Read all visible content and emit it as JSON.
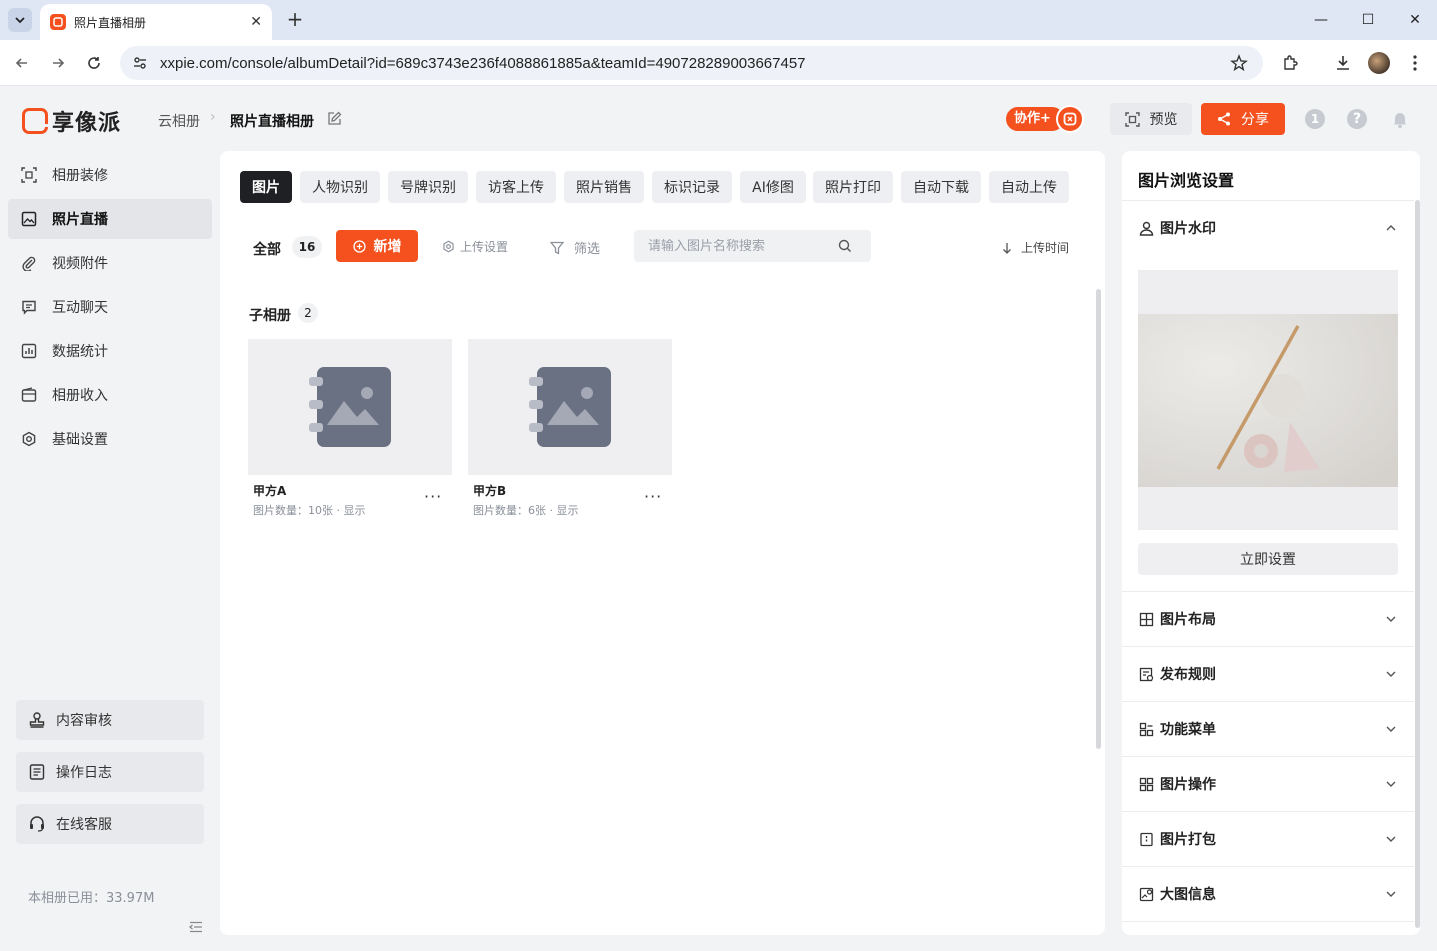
{
  "browser": {
    "tab_title": "照片直播相册",
    "url": "xxpie.com/console/albumDetail?id=689c3743e236f4088861885a&teamId=490728289003667457"
  },
  "header": {
    "logo_text": "享像派",
    "breadcrumb_parent": "云相册",
    "breadcrumb_current": "照片直播相册",
    "collab_label": "协作+",
    "preview_label": "预览",
    "share_label": "分享",
    "notification_count": "1"
  },
  "sidebar": {
    "items": [
      {
        "label": "相册装修",
        "icon": "scan-icon"
      },
      {
        "label": "照片直播",
        "icon": "image-icon"
      },
      {
        "label": "视频附件",
        "icon": "paperclip-icon"
      },
      {
        "label": "互动聊天",
        "icon": "chat-icon"
      },
      {
        "label": "数据统计",
        "icon": "chart-icon"
      },
      {
        "label": "相册收入",
        "icon": "wallet-icon"
      },
      {
        "label": "基础设置",
        "icon": "gear-icon"
      }
    ],
    "active_index": 1,
    "bottom_buttons": [
      {
        "label": "内容审核",
        "icon": "stamp-icon"
      },
      {
        "label": "操作日志",
        "icon": "log-icon"
      },
      {
        "label": "在线客服",
        "icon": "headset-icon"
      }
    ],
    "usage_text": "本相册已用：33.97M"
  },
  "main": {
    "tabs": [
      "图片",
      "人物识别",
      "号牌识别",
      "访客上传",
      "照片销售",
      "标识记录",
      "AI修图",
      "照片打印",
      "自动下载",
      "自动上传"
    ],
    "active_tab": 0,
    "all_label": "全部",
    "all_count": "16",
    "add_label": "新增",
    "upload_settings_label": "上传设置",
    "filter_label": "筛选",
    "search_placeholder": "请输入图片名称搜索",
    "sort_label": "上传时间",
    "sub_album_title": "子相册",
    "sub_album_count": "2",
    "albums": [
      {
        "name": "甲方A",
        "meta": "图片数量：10张 · 显示"
      },
      {
        "name": "甲方B",
        "meta": "图片数量：6张 · 显示"
      }
    ]
  },
  "right_panel": {
    "title": "图片浏览设置",
    "watermark": {
      "label": "图片水印",
      "button": "立即设置"
    },
    "sections": [
      {
        "label": "图片布局",
        "icon": "layout-icon"
      },
      {
        "label": "发布规则",
        "icon": "rule-icon"
      },
      {
        "label": "功能菜单",
        "icon": "menu-icon"
      },
      {
        "label": "图片操作",
        "icon": "grid-icon"
      },
      {
        "label": "图片打包",
        "icon": "package-icon"
      },
      {
        "label": "大图信息",
        "icon": "image-info-icon"
      }
    ]
  },
  "colors": {
    "brand": "#f4511e",
    "active_tab": "#1f2024",
    "page_bg": "#f2f3f5"
  }
}
